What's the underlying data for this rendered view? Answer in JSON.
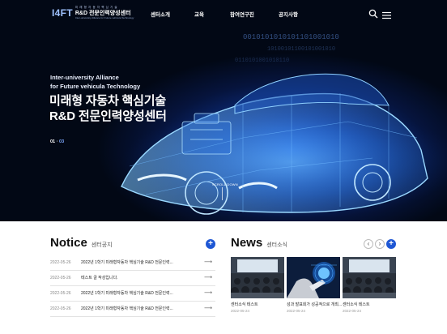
{
  "header": {
    "logo": {
      "mark": "I4FT",
      "small": "미 래 형 자 동 차 핵 심 기 술",
      "main": "R&D 전문인력양성센터",
      "sub": "Inter-university Alliance for Future vehicula Technology"
    },
    "nav": [
      "센터소개",
      "교육",
      "참여연구진",
      "공지사항"
    ],
    "icons": {
      "search": "search-icon",
      "menu": "hamburger-menu-icon"
    }
  },
  "hero": {
    "subtitle_line1": "Inter-university Alliance",
    "subtitle_line2": "for Future vehicula Technology",
    "title_line1": "미래형 자동차 핵심기술",
    "title_line2": "R&D 전문인력양성센터",
    "pager_current": "01",
    "pager_total": "03",
    "scroll_label": "SCROLL DOWN",
    "binary_text": "0010101010101101001010"
  },
  "notice": {
    "title": "Notice",
    "subtitle": "센터공지",
    "more": "+",
    "items": [
      {
        "date": "2022-05-26",
        "text": "2022년 1학기 미래형자동차 핵심기술 R&D 전문인력..."
      },
      {
        "date": "2022-05-26",
        "text": "테스트 글 작성입니다."
      },
      {
        "date": "2022-05-26",
        "text": "2022년 1학기 미래형자동차 핵심기술 R&D 전문인력..."
      },
      {
        "date": "2022-05-26",
        "text": "2022년 1학기 미래형자동차 핵심기술 R&D 전문인력..."
      }
    ]
  },
  "news": {
    "title": "News",
    "subtitle": "센터소식",
    "prev": "‹",
    "next": "›",
    "more": "+",
    "items": [
      {
        "caption": "센터소식 테스트",
        "date": "2022-05-24"
      },
      {
        "caption": "성과 발표회가 성공적으로 개최...",
        "date": "2022-05-24"
      },
      {
        "caption": "센터소식 테스트",
        "date": "2022-05-24"
      }
    ]
  },
  "colors": {
    "accent": "#1e57d4",
    "hero_bg": "#06143d",
    "glow": "#3fa0ff"
  }
}
